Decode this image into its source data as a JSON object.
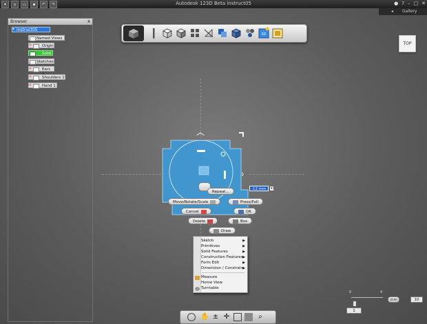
{
  "window": {
    "title": "Autodesk 123D Beta   instruct05",
    "gallery_label": "Gallery",
    "help_label": "?"
  },
  "browser": {
    "title": "Browser",
    "close_label": "x",
    "root": "instruct05",
    "items": [
      {
        "label": "Named Views",
        "kind": "folder"
      },
      {
        "label": "Origin",
        "kind": "folder"
      },
      {
        "label": "Solid",
        "kind": "folder",
        "active": true
      },
      {
        "label": "Sketches",
        "kind": "folder"
      },
      {
        "label": "Ears 1",
        "kind": "sketch"
      },
      {
        "label": "Shoulders 1",
        "kind": "sketch"
      },
      {
        "label": "Hand 1",
        "kind": "sketch"
      }
    ]
  },
  "toolbar": {
    "icons": [
      "home-cube-icon",
      "pencil-icon",
      "box-primitive-icon",
      "solid-features-icon",
      "pattern-icon",
      "construction-icon",
      "bool-icon",
      "tweak-icon",
      "group-icon",
      "123d-logo-icon",
      "material-icon"
    ]
  },
  "viewcube": {
    "label": "TOP"
  },
  "dimension": {
    "value": "-12 mm"
  },
  "marking_menu": {
    "repeat": "Repeat...",
    "move": "Move/Rotate/Scale",
    "presspull": "Press/Pull",
    "cancel": "Cancel",
    "ok": "OK",
    "delete": "Delete",
    "box": "Box",
    "draw": "Draw"
  },
  "context_menu": {
    "items": [
      {
        "label": "Sketch",
        "submenu": true
      },
      {
        "label": "Primitives",
        "submenu": true
      },
      {
        "label": "Solid Features",
        "submenu": true
      },
      {
        "label": "Construction Features",
        "submenu": true
      },
      {
        "label": "Form Edit",
        "submenu": true
      },
      {
        "label": "Dimension / Constrain",
        "submenu": true
      }
    ],
    "items2": [
      {
        "label": "Measure",
        "icon": "ruler-icon"
      },
      {
        "label": "Home View",
        "icon": ""
      },
      {
        "label": "Turntable",
        "icon": "turntable-icon"
      }
    ]
  },
  "grid": {
    "tick_min": "0",
    "tick_mid": "4",
    "snap_value": "1",
    "unit": "mm",
    "grid_value": "10"
  },
  "colors": {
    "accent": "#2e8fd8",
    "sketch_fill": "#4aa3e0",
    "active_green": "#3ac23a"
  }
}
